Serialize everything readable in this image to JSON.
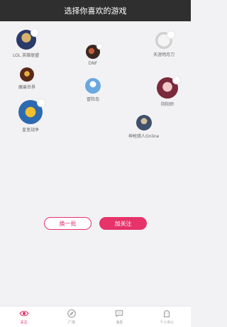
{
  "header": {
    "title": "选择你喜欢的游戏"
  },
  "games": [
    {
      "name": "LOL 英雄联盟",
      "icon": "lol-icon"
    },
    {
      "name": "DNF",
      "icon": "dnf-icon"
    },
    {
      "name": "天涯明月刀",
      "icon": "tianya-icon"
    },
    {
      "name": "魔兽世界",
      "icon": "wow-icon"
    },
    {
      "name": "冒险岛",
      "icon": "maplestory-icon"
    },
    {
      "name": "阴阳师",
      "icon": "onmyoji-icon"
    },
    {
      "name": "皇室战争",
      "icon": "clash-royale-icon"
    },
    {
      "name": "神枪猎人Online",
      "icon": "hunter-icon"
    }
  ],
  "actions": {
    "change_batch": "换一批",
    "follow": "加关注"
  },
  "tabs": [
    {
      "label": "关注",
      "icon": "eye-icon",
      "active": true
    },
    {
      "label": "广场",
      "icon": "compass-icon",
      "active": false
    },
    {
      "label": "消息",
      "icon": "chat-icon",
      "active": false
    },
    {
      "label": "个人中心",
      "icon": "person-icon",
      "active": false
    }
  ],
  "colors": {
    "accent": "#e6336a",
    "header": "#2f2f2f"
  }
}
